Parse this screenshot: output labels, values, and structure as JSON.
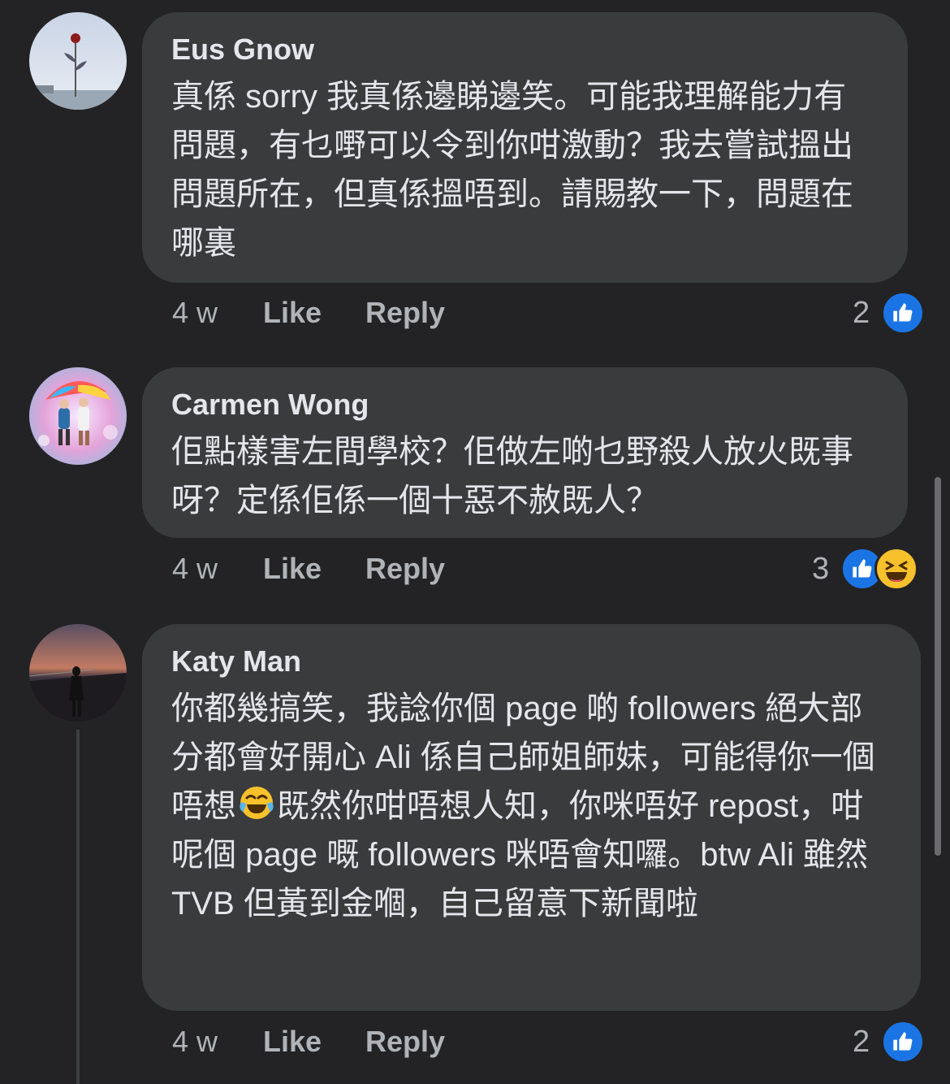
{
  "comments": [
    {
      "author": "Eus Gnow",
      "text": "真係 sorry 我真係邊睇邊笑。可能我理解能力有問題，有乜嘢可以令到你咁激動？我去嘗試搵出問題所在，但真係搵唔到。請賜教一下，問題在哪裏",
      "time": "4 w",
      "like_label": "Like",
      "reply_label": "Reply",
      "reaction_count": "2",
      "reactions": [
        "like-icon"
      ]
    },
    {
      "author": "Carmen Wong",
      "text": "佢點樣害左間學校？佢做左啲乜野殺人放火既事呀？定係佢係一個十惡不赦既人？",
      "time": "4 w",
      "like_label": "Like",
      "reply_label": "Reply",
      "reaction_count": "3",
      "reactions": [
        "like-icon",
        "haha-icon"
      ]
    },
    {
      "author": "Katy Man",
      "text_part1": "你都幾搞笑，我諗你個 page 啲 followers 絕大部分都會好開心 Ali 係自己師姐師妹，可能得你一個唔想",
      "text_part2": "既然你咁唔想人知，你咪唔好 repost，咁呢個 page 嘅 followers 咪唔會知囉。btw Ali 雖然 TVB 但黃到金嗰，自己留意下新聞啦",
      "inline_emoji": "joy-emoji",
      "time": "4 w",
      "like_label": "Like",
      "reply_label": "Reply",
      "reaction_count": "2",
      "reactions": [
        "like-icon"
      ]
    }
  ],
  "colors": {
    "background": "#232325",
    "bubble": "#3a3b3d",
    "text": "#e4e6eb",
    "meta": "#b0b3b8",
    "like_blue": "#1b74e4",
    "haha_yellow": "#f7c12b"
  }
}
